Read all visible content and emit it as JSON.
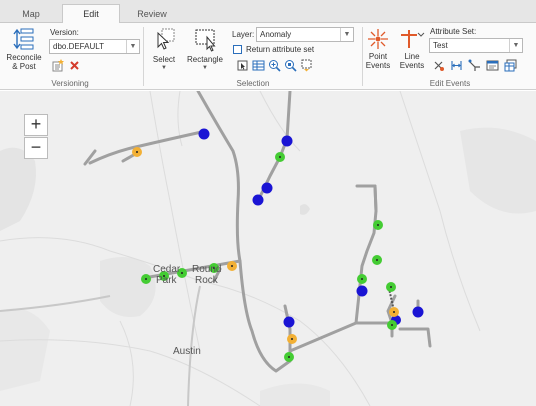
{
  "tabs": [
    {
      "label": "Map",
      "active": false
    },
    {
      "label": "Edit",
      "active": true
    },
    {
      "label": "Review",
      "active": false
    }
  ],
  "versioning": {
    "reconcile_label_line1": "Reconcile",
    "reconcile_label_line2": "& Post",
    "version_label": "Version:",
    "version_value": "dbo.DEFAULT",
    "group_label": "Versioning"
  },
  "selection": {
    "select_label": "Select",
    "rectangle_label": "Rectangle",
    "layer_label": "Layer:",
    "layer_value": "Anomaly",
    "return_attribute_label": "Return attribute set",
    "group_label": "Selection"
  },
  "edit_events": {
    "point_events_line1": "Point",
    "point_events_line2": "Events",
    "line_events_line1": "Line",
    "line_events_line2": "Events",
    "attribute_set_label": "Attribute Set:",
    "attribute_set_value": "Test",
    "group_label": "Edit Events"
  },
  "map": {
    "zoom_in": "+",
    "zoom_out": "−",
    "labels": {
      "cedar_park_1": "Cedar",
      "cedar_park_2": "Park",
      "round_rock_1": "Round",
      "round_rock_2": "Rock",
      "austin": "Austin"
    },
    "colors": {
      "background": "#efefef",
      "road": "#c8c8c8",
      "route": "#a0a0a0",
      "point_blue": "#1a14d4",
      "point_green": "#44cc33",
      "point_orange": "#f2b035"
    }
  }
}
